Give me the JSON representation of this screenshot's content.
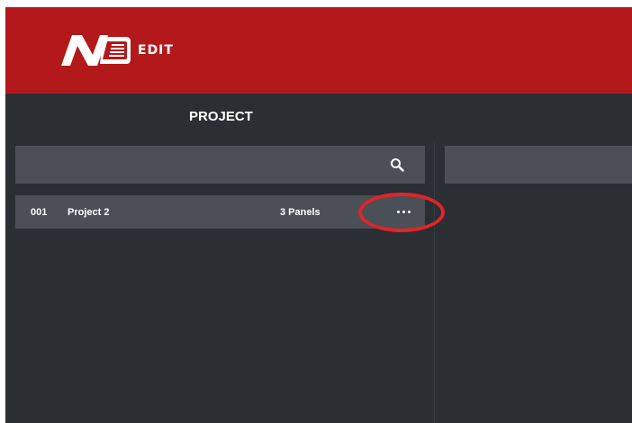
{
  "header": {
    "app_name": "EDIT",
    "logo_icon": "ne-logo-icon"
  },
  "section": {
    "title": "PROJECT"
  },
  "search": {
    "placeholder": "",
    "icon": "search-icon"
  },
  "projects": [
    {
      "number": "001",
      "name": "Project 2",
      "panels": "3 Panels",
      "menu_icon": "more-horizontal-icon"
    }
  ],
  "colors": {
    "header_bg": "#b3191b",
    "body_bg": "#2b2f33",
    "panel_bg": "#4a5056",
    "highlight": "#e0242a"
  }
}
